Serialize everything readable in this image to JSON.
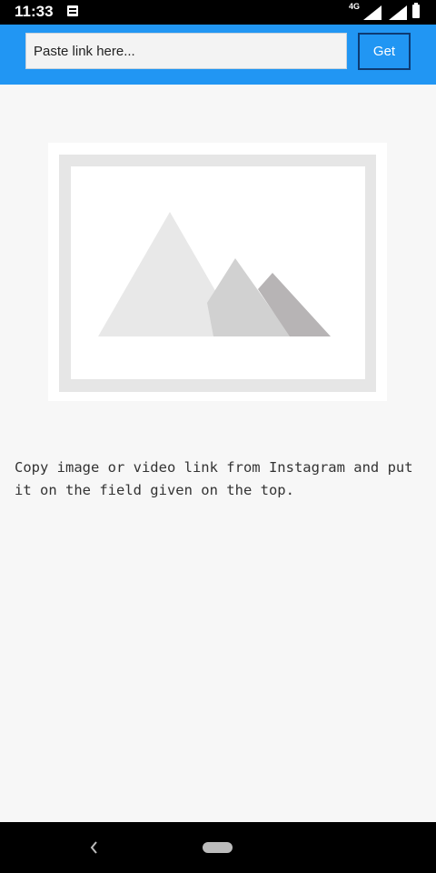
{
  "status_bar": {
    "time": "11:33",
    "network": "4G",
    "notification_icon": "notification-icon",
    "signal_icon": "signal-icon",
    "battery_icon": "battery-icon"
  },
  "top_bar": {
    "color": "#2196f3",
    "link_input": {
      "placeholder": "Paste link here...",
      "value": ""
    },
    "get_button_label": "Get"
  },
  "content": {
    "placeholder_image_icon": "image-placeholder-icon",
    "instruction": "Copy image or video link from Instagram and put it on the field given on the top."
  },
  "nav_bar": {
    "back_icon": "back-icon",
    "home_icon": "home-pill-icon"
  }
}
